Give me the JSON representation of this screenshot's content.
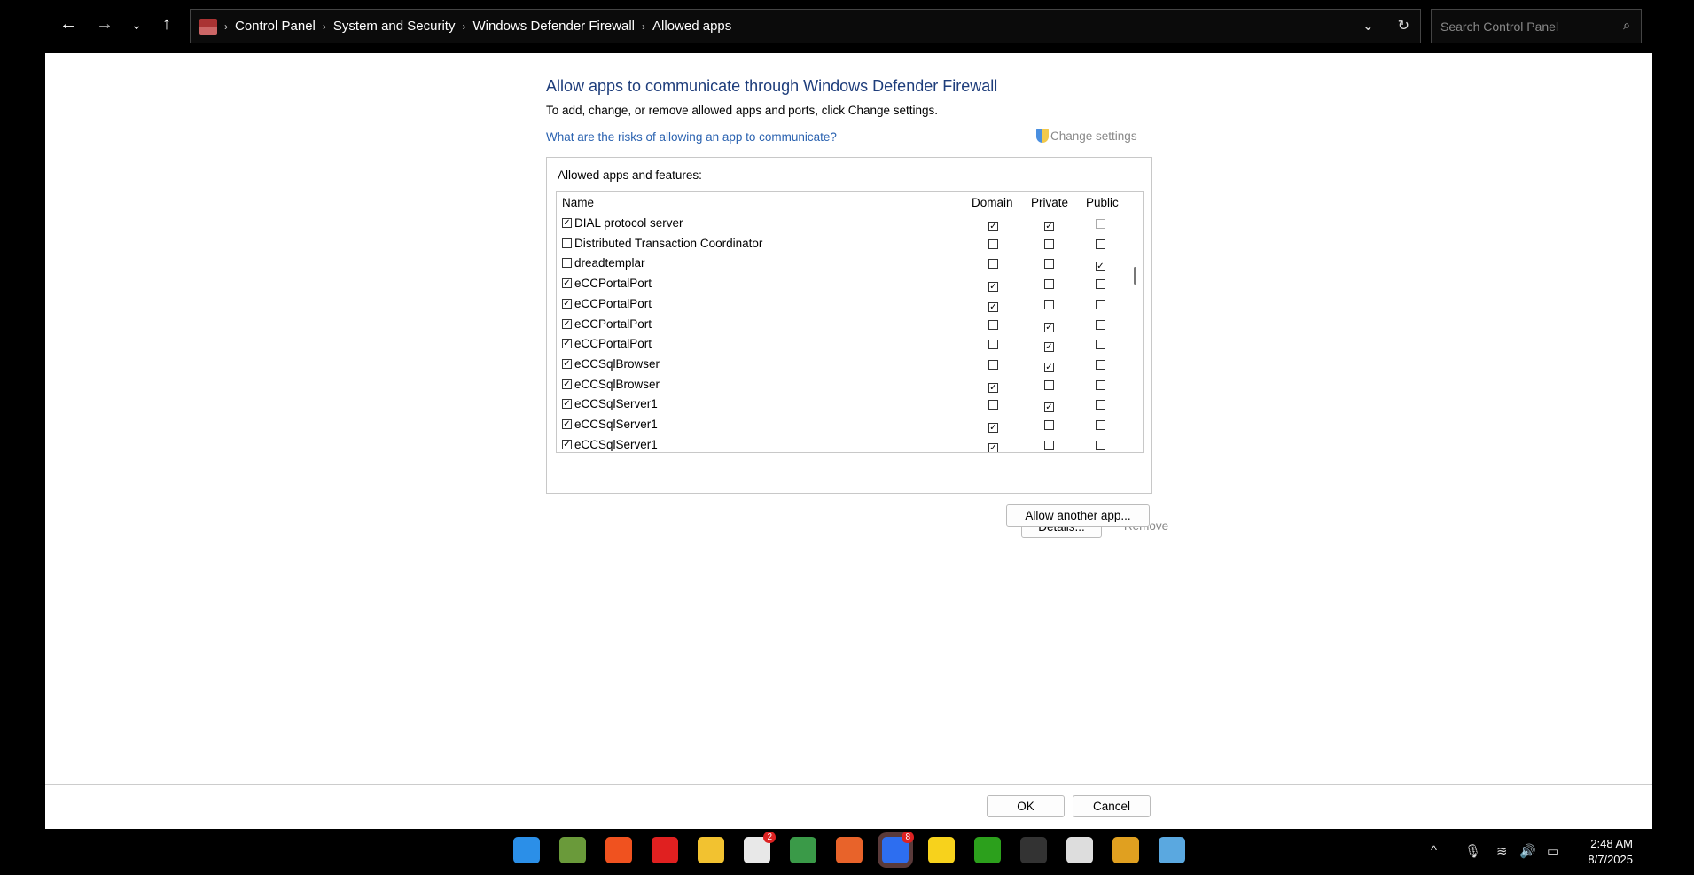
{
  "breadcrumb": [
    "Control Panel",
    "System and Security",
    "Windows Defender Firewall",
    "Allowed apps"
  ],
  "search": {
    "placeholder": "Search Control Panel"
  },
  "page": {
    "title": "Allow apps to communicate through Windows Defender Firewall",
    "subtitle": "To add, change, or remove allowed apps and ports, click Change settings.",
    "risk_link": "What are the risks of allowing an app to communicate?",
    "change_settings": "Change settings",
    "group_label": "Allowed apps and features:"
  },
  "columns": {
    "name": "Name",
    "domain": "Domain",
    "private": "Private",
    "public": "Public"
  },
  "rows": [
    {
      "name": "DIAL protocol server",
      "enabled": true,
      "domain": true,
      "private": true,
      "public": false
    },
    {
      "name": "Distributed Transaction Coordinator",
      "enabled": false,
      "domain": false,
      "private": false,
      "public": false
    },
    {
      "name": "dreadtemplar",
      "enabled": false,
      "domain": false,
      "private": false,
      "public": true
    },
    {
      "name": "eCCPortalPort",
      "enabled": true,
      "domain": true,
      "private": false,
      "public": false
    },
    {
      "name": "eCCPortalPort",
      "enabled": true,
      "domain": true,
      "private": false,
      "public": false
    },
    {
      "name": "eCCPortalPort",
      "enabled": true,
      "domain": false,
      "private": true,
      "public": false
    },
    {
      "name": "eCCPortalPort",
      "enabled": true,
      "domain": false,
      "private": true,
      "public": false
    },
    {
      "name": "eCCSqlBrowser",
      "enabled": true,
      "domain": false,
      "private": true,
      "public": false
    },
    {
      "name": "eCCSqlBrowser",
      "enabled": true,
      "domain": true,
      "private": false,
      "public": false
    },
    {
      "name": "eCCSqlServer1",
      "enabled": true,
      "domain": false,
      "private": true,
      "public": false
    },
    {
      "name": "eCCSqlServer1",
      "enabled": true,
      "domain": true,
      "private": false,
      "public": false
    },
    {
      "name": "eCCSqlServer1",
      "enabled": true,
      "domain": true,
      "private": false,
      "public": false
    }
  ],
  "buttons": {
    "details": "Details...",
    "remove": "Remove",
    "allow_another": "Allow another app...",
    "ok": "OK",
    "cancel": "Cancel"
  },
  "taskbar": {
    "apps": [
      {
        "name": "start",
        "color": "#2b8fe8",
        "badge": ""
      },
      {
        "name": "notepad",
        "color": "#6a9a3a",
        "badge": ""
      },
      {
        "name": "brave",
        "color": "#f0521f",
        "badge": ""
      },
      {
        "name": "wps",
        "color": "#e02020",
        "badge": ""
      },
      {
        "name": "file-explorer",
        "color": "#f2c230",
        "badge": ""
      },
      {
        "name": "slack",
        "color": "#e8e8e8",
        "badge": "2"
      },
      {
        "name": "chrome",
        "color": "#3a9a48",
        "badge": ""
      },
      {
        "name": "wps-writer",
        "color": "#e8632a",
        "badge": ""
      },
      {
        "name": "zoom",
        "color": "#2d6ef0",
        "badge": "8"
      },
      {
        "name": "sticky-notes",
        "color": "#f7d21c",
        "badge": ""
      },
      {
        "name": "quickbooks",
        "color": "#2ca01c",
        "badge": ""
      },
      {
        "name": "obs",
        "color": "#333",
        "badge": ""
      },
      {
        "name": "snipping",
        "color": "#ddd",
        "badge": ""
      },
      {
        "name": "chrome-canary",
        "color": "#e0a020",
        "badge": ""
      },
      {
        "name": "control-panel",
        "color": "#5aa8e0",
        "badge": ""
      }
    ],
    "time": "2:48 AM",
    "date": "8/7/2025"
  }
}
